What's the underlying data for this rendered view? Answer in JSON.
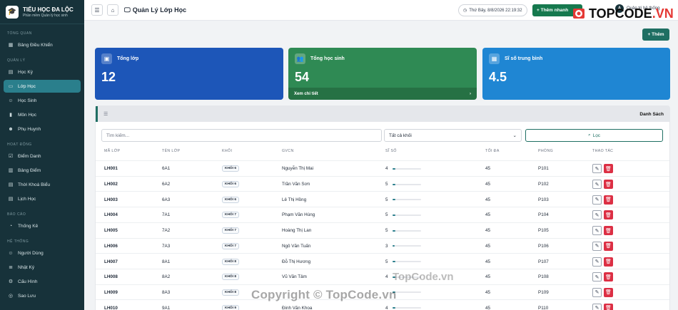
{
  "sidebar": {
    "brand_title": "TIỂU HỌC ĐA LỘC",
    "brand_sub": "Phần mềm Quản lý học sinh",
    "sections": [
      {
        "label": "Tổng quan",
        "items": [
          {
            "label": "Bảng Điều Khiển",
            "icon": "grid-icon"
          }
        ]
      },
      {
        "label": "Quản lý",
        "items": [
          {
            "label": "Học Kỳ",
            "icon": "calendar-icon"
          },
          {
            "label": "Lớp Học",
            "icon": "monitor-icon",
            "active": true
          },
          {
            "label": "Học Sinh",
            "icon": "students-icon"
          },
          {
            "label": "Môn Học",
            "icon": "book-icon"
          },
          {
            "label": "Phụ Huynh",
            "icon": "parents-icon"
          }
        ]
      },
      {
        "label": "Hoạt động",
        "items": [
          {
            "label": "Điểm Danh",
            "icon": "checklist-icon"
          },
          {
            "label": "Bảng Điểm",
            "icon": "bar-chart-icon"
          },
          {
            "label": "Thời Khoá Biểu",
            "icon": "timetable-icon"
          },
          {
            "label": "Lịch Học",
            "icon": "calendar-icon"
          }
        ]
      },
      {
        "label": "Báo cáo",
        "items": [
          {
            "label": "Thống Kê",
            "icon": "pie-chart-icon"
          }
        ]
      },
      {
        "label": "Hệ thống",
        "items": [
          {
            "label": "Người Dùng",
            "icon": "users-icon"
          },
          {
            "label": "Nhật Ký",
            "icon": "log-icon"
          },
          {
            "label": "Cấu Hình",
            "icon": "gear-icon"
          },
          {
            "label": "Sao Lưu",
            "icon": "database-icon"
          }
        ]
      }
    ]
  },
  "header": {
    "page_title": "Quản Lý Lớp Học",
    "clock": "Thứ Bảy, 8/8/2026 22:19:32",
    "add_quick": "+ Thêm nhanh",
    "user_initial": "A",
    "user_name": "Quản trị hệ thống",
    "watermark": "TOPCODE",
    "watermark_tld": ".VN"
  },
  "add_button": "+ Thêm",
  "stats": [
    {
      "label": "Tổng lớp",
      "value": "12",
      "color": "#1d56b8",
      "icon": "door-icon"
    },
    {
      "label": "Tổng học sinh",
      "value": "54",
      "color": "#2f8a54",
      "icon": "students-icon",
      "footer": "Xem chi tiết"
    },
    {
      "label": "Sĩ số trung bình",
      "value": "4.5",
      "color": "#1f86d3",
      "icon": "calculator-icon"
    }
  ],
  "list": {
    "title": "Danh Sách",
    "search_placeholder": "Tìm kiếm...",
    "grade_filter": "Tất cả khối",
    "filter_button": "Lọc",
    "columns": [
      "Mã lớp",
      "Tên lớp",
      "Khối",
      "GVCN",
      "Sĩ số",
      "Tối đa",
      "Phòng",
      "Thao tác"
    ],
    "rows": [
      {
        "code": "LH001",
        "name": "6A1",
        "grade": "KHỐI 6",
        "teacher": "Nguyễn Thị Mai",
        "size": "4",
        "size_frac": 0.09,
        "max": "45",
        "room": "P101"
      },
      {
        "code": "LH002",
        "name": "6A2",
        "grade": "KHỐI 6",
        "teacher": "Trần Văn Sơn",
        "size": "5",
        "size_frac": 0.11,
        "max": "45",
        "room": "P102"
      },
      {
        "code": "LH003",
        "name": "6A3",
        "grade": "KHỐI 6",
        "teacher": "Lê Thị Hồng",
        "size": "5",
        "size_frac": 0.11,
        "max": "45",
        "room": "P103"
      },
      {
        "code": "LH004",
        "name": "7A1",
        "grade": "KHỐI 7",
        "teacher": "Phạm Văn Hùng",
        "size": "5",
        "size_frac": 0.11,
        "max": "45",
        "room": "P104"
      },
      {
        "code": "LH005",
        "name": "7A2",
        "grade": "KHỐI 7",
        "teacher": "Hoàng Thị Lan",
        "size": "5",
        "size_frac": 0.11,
        "max": "45",
        "room": "P105"
      },
      {
        "code": "LH006",
        "name": "7A3",
        "grade": "KHỐI 7",
        "teacher": "Ngô Văn Tuấn",
        "size": "3",
        "size_frac": 0.07,
        "max": "45",
        "room": "P106"
      },
      {
        "code": "LH007",
        "name": "8A1",
        "grade": "KHỐI 8",
        "teacher": "Đỗ Thị Hương",
        "size": "5",
        "size_frac": 0.11,
        "max": "45",
        "room": "P107"
      },
      {
        "code": "LH008",
        "name": "8A2",
        "grade": "KHỐI 8",
        "teacher": "Vũ Văn Tâm",
        "size": "4",
        "size_frac": 0.09,
        "max": "45",
        "room": "P108"
      },
      {
        "code": "LH009",
        "name": "8A3",
        "grade": "KHỐI 8",
        "teacher": "",
        "size": "",
        "size_frac": 0.09,
        "max": "45",
        "room": "P109"
      },
      {
        "code": "LH010",
        "name": "9A1",
        "grade": "KHỐI 9",
        "teacher": "Đinh Văn Khoa",
        "size": "4",
        "size_frac": 0.09,
        "max": "45",
        "room": "P110"
      }
    ]
  },
  "watermark_copy": "Copyright © TopCode.vn",
  "watermark_center": "TopCode.vn"
}
